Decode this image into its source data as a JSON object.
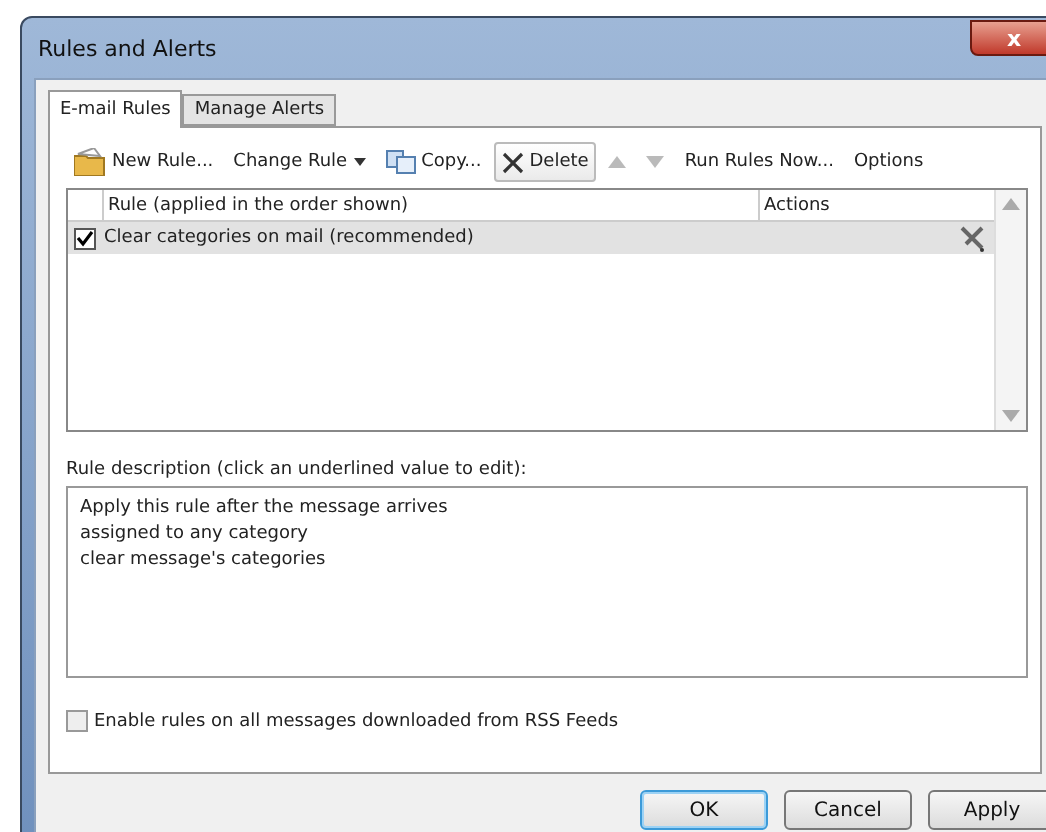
{
  "window": {
    "title": "Rules and Alerts",
    "close": "x"
  },
  "tabs": [
    {
      "label": "E-mail Rules",
      "selected": true
    },
    {
      "label": "Manage Alerts",
      "selected": false
    }
  ],
  "toolbar": [
    {
      "kind": "new",
      "label": "New Rule...",
      "disabled": false
    },
    {
      "kind": "dropdown",
      "label": "Change Rule",
      "disabled": false
    },
    {
      "kind": "copy",
      "label": "Copy...",
      "disabled": false
    },
    {
      "kind": "delete",
      "label": "Delete",
      "disabled": false
    },
    {
      "kind": "up",
      "disabled": true
    },
    {
      "kind": "down",
      "disabled": true
    },
    {
      "kind": "plain",
      "label": "Run Rules Now...",
      "disabled": false
    },
    {
      "kind": "plain",
      "label": "Options",
      "disabled": false
    }
  ],
  "table": {
    "columns": [
      "Rule (applied in the order shown)",
      "Actions"
    ],
    "rows": [
      {
        "rule": "Clear categories on mail (recommended)",
        "checked": true,
        "selected": true
      }
    ]
  },
  "description": {
    "label": "Rule description (click an underlined value to edit):",
    "lines": [
      "Apply this rule after the message arrives",
      "assigned to any category",
      "clear message's categories"
    ]
  },
  "rss": {
    "label": "Enable rules on all messages downloaded from RSS Feeds",
    "checked": false
  },
  "buttons": [
    {
      "label": "OK",
      "default": true
    },
    {
      "label": "Cancel",
      "default": false
    },
    {
      "label": "Apply",
      "default": false
    }
  ]
}
